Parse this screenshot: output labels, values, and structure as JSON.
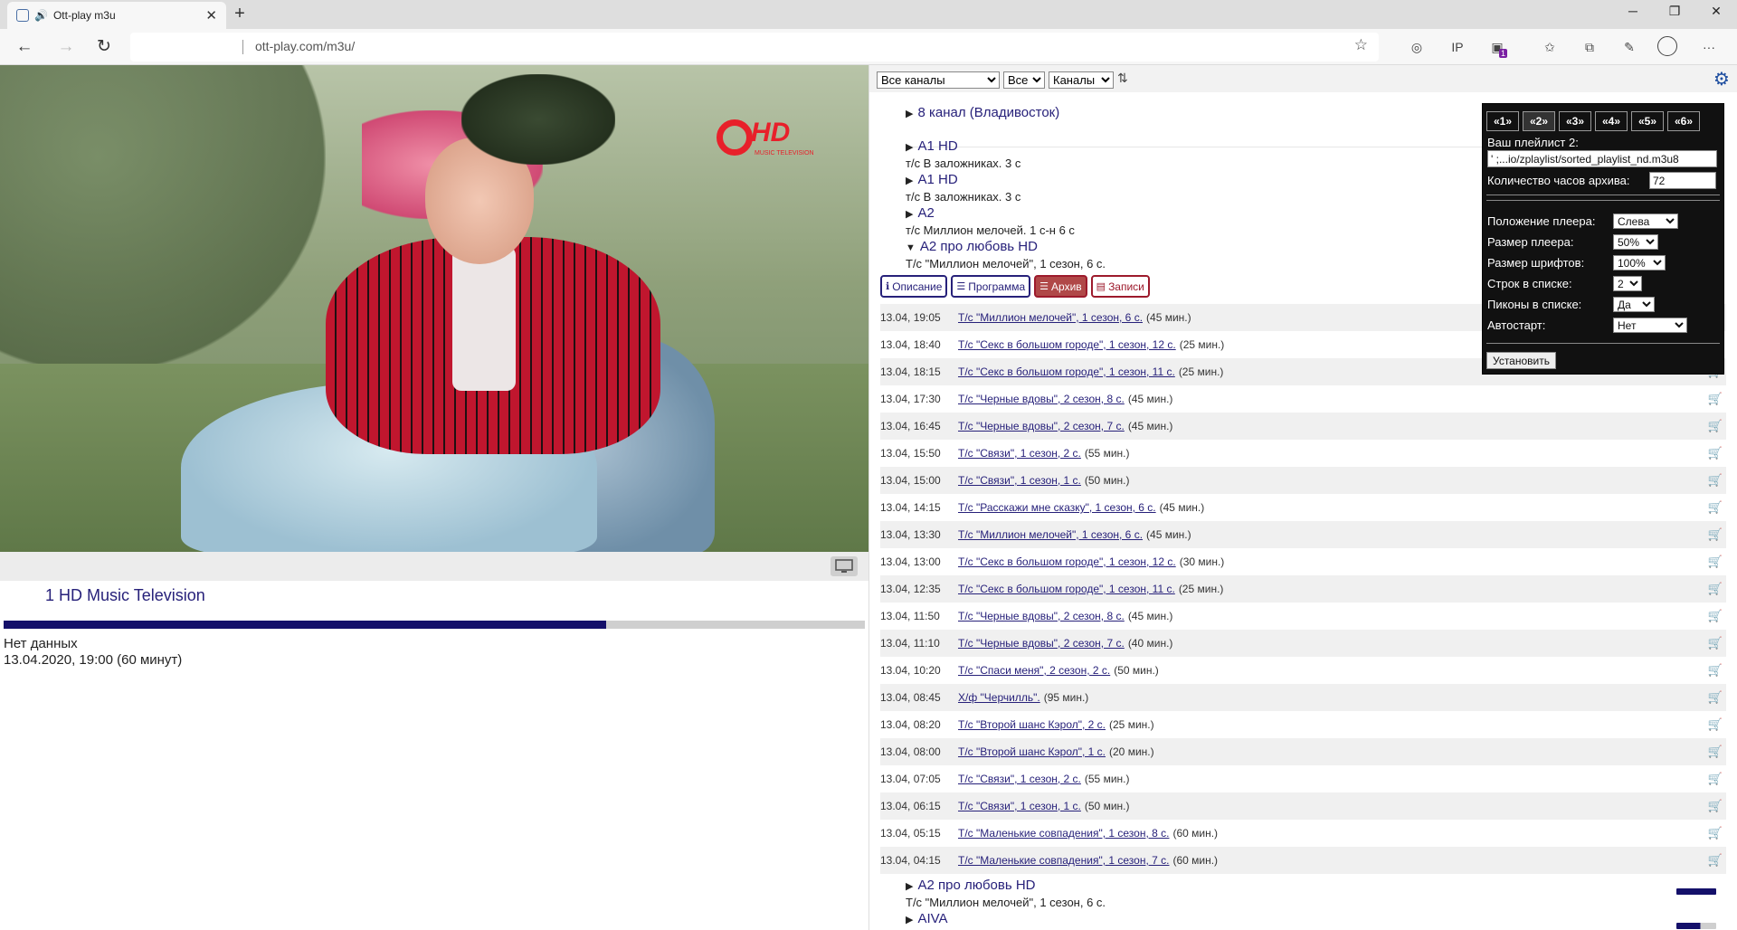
{
  "browser": {
    "tab_title": "Ott-play m3u",
    "new_tab": "+",
    "url": "ott-play.com/m3u/",
    "win_minimize": "─",
    "win_restore": "❐",
    "win_close": "✕",
    "back": "←",
    "forward": "→",
    "reload": "↻",
    "star": "☆",
    "menu": "···"
  },
  "player": {
    "logo_text": "HD",
    "logo_sub": "MUSIC TELEVISION",
    "now_title": "1 HD Music Television",
    "progress": 0.7,
    "status": "Нет данных",
    "time": "13.04.2020, 19:00 (60 минут)"
  },
  "toolbar": {
    "filter1": "Все каналы",
    "filter2": "Все",
    "filter3": "Каналы",
    "sort_icon": "⇅"
  },
  "channels_top": [
    {
      "name": "8 канал (Владивосток)",
      "sub": ""
    },
    {
      "name": "A1 HD",
      "sub": "т/с В заложниках. 3 с"
    },
    {
      "name": "A1 HD",
      "sub": "т/с В заложниках. 3 с"
    },
    {
      "name": "A2",
      "sub": "т/с Миллион мелочей. 1 с-н 6 с"
    },
    {
      "name": "A2 про любовь HD",
      "sub": "Т/с \"Миллион мелочей\", 1 сезон, 6 с."
    }
  ],
  "tabs": {
    "desc": "Описание",
    "program": "Программа",
    "archive": "Архив",
    "records": "Записи"
  },
  "archive": [
    {
      "time": "13.04, 19:05",
      "name": "Т/с \"Миллион мелочей\", 1 сезон, 6 с.",
      "dur": "(45 мин.)"
    },
    {
      "time": "13.04, 18:40",
      "name": "Т/с \"Секс в большом городе\", 1 сезон, 12 с.",
      "dur": "(25 мин.)"
    },
    {
      "time": "13.04, 18:15",
      "name": "Т/с \"Секс в большом городе\", 1 сезон, 11 с.",
      "dur": "(25 мин.)"
    },
    {
      "time": "13.04, 17:30",
      "name": "Т/с \"Черные вдовы\", 2 сезон, 8 с.",
      "dur": "(45 мин.)"
    },
    {
      "time": "13.04, 16:45",
      "name": "Т/с \"Черные вдовы\", 2 сезон, 7 с.",
      "dur": "(45 мин.)"
    },
    {
      "time": "13.04, 15:50",
      "name": "Т/с \"Связи\", 1 сезон, 2 с.",
      "dur": "(55 мин.)"
    },
    {
      "time": "13.04, 15:00",
      "name": "Т/с \"Связи\", 1 сезон, 1 с.",
      "dur": "(50 мин.)"
    },
    {
      "time": "13.04, 14:15",
      "name": "Т/с \"Расскажи мне сказку\", 1 сезон, 6 с.",
      "dur": "(45 мин.)"
    },
    {
      "time": "13.04, 13:30",
      "name": "Т/с \"Миллион мелочей\", 1 сезон, 6 с.",
      "dur": "(45 мин.)"
    },
    {
      "time": "13.04, 13:00",
      "name": "Т/с \"Секс в большом городе\", 1 сезон, 12 с.",
      "dur": "(30 мин.)"
    },
    {
      "time": "13.04, 12:35",
      "name": "Т/с \"Секс в большом городе\", 1 сезон, 11 с.",
      "dur": "(25 мин.)"
    },
    {
      "time": "13.04, 11:50",
      "name": "Т/с \"Черные вдовы\", 2 сезон, 8 с.",
      "dur": "(45 мин.)"
    },
    {
      "time": "13.04, 11:10",
      "name": "Т/с \"Черные вдовы\", 2 сезон, 7 с.",
      "dur": "(40 мин.)"
    },
    {
      "time": "13.04, 10:20",
      "name": "Т/с \"Спаси меня\", 2 сезон, 2 с.",
      "dur": "(50 мин.)"
    },
    {
      "time": "13.04, 08:45",
      "name": "Х/ф \"Черчилль\".",
      "dur": "(95 мин.)"
    },
    {
      "time": "13.04, 08:20",
      "name": "Т/с \"Второй шанс Кэрол\", 2 с.",
      "dur": "(25 мин.)"
    },
    {
      "time": "13.04, 08:00",
      "name": "Т/с \"Второй шанс Кэрол\", 1 с.",
      "dur": "(20 мин.)"
    },
    {
      "time": "13.04, 07:05",
      "name": "Т/с \"Связи\", 1 сезон, 2 с.",
      "dur": "(55 мин.)"
    },
    {
      "time": "13.04, 06:15",
      "name": "Т/с \"Связи\", 1 сезон, 1 с.",
      "dur": "(50 мин.)"
    },
    {
      "time": "13.04, 05:15",
      "name": "Т/с \"Маленькие совпадения\", 1 сезон, 8 с.",
      "dur": "(60 мин.)"
    },
    {
      "time": "13.04, 04:15",
      "name": "Т/с \"Маленькие совпадения\", 1 сезон, 7 с.",
      "dur": "(60 мин.)"
    }
  ],
  "channels_bottom": [
    {
      "name": "A2 про любовь HD",
      "sub": "Т/с \"Миллион мелочей\", 1 сезон, 6 с."
    },
    {
      "name": "AIVA",
      "sub": ""
    }
  ],
  "settings": {
    "tabs": [
      "«1»",
      "«2»",
      "«3»",
      "«4»",
      "«5»",
      "«6»"
    ],
    "active_tab": 1,
    "playlist_label": "Ваш плейлист 2:",
    "playlist_value": "' ;...io/zplaylist/sorted_playlist_nd.m3u8",
    "archive_hours_label": "Количество часов архива:",
    "archive_hours_value": "72",
    "position_label": "Положение плеера:",
    "position_value": "Слева",
    "size_label": "Размер плеера:",
    "size_value": "50%",
    "font_label": "Размер шрифтов:",
    "font_value": "100%",
    "rows_label": "Строк в списке:",
    "rows_value": "2",
    "icons_label": "Пиконы в списке:",
    "icons_value": "Да",
    "autostart_label": "Автостарт:",
    "autostart_value": "Нет",
    "apply_button": "Установить"
  },
  "icons": {
    "gear": "⚙",
    "cart": "🛒",
    "star": "☆",
    "sort": "⇅"
  }
}
